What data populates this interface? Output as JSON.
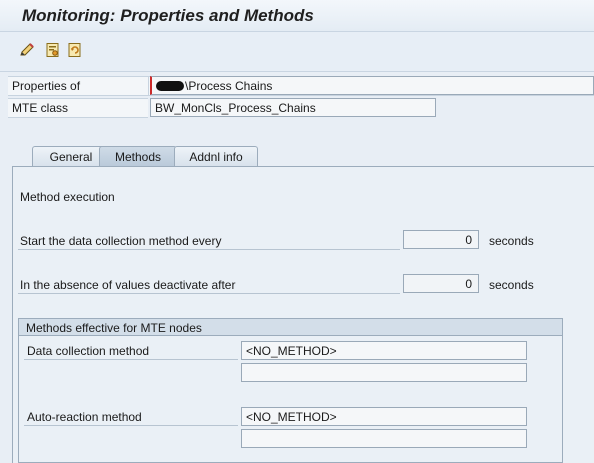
{
  "window": {
    "title": "Monitoring: Properties and Methods"
  },
  "toolbar": {
    "icons": [
      "change-pencil-icon",
      "details-icon",
      "refresh-icon"
    ]
  },
  "header": {
    "properties_label": "Properties of",
    "properties_value": "\\Process Chains",
    "mte_class_label": "MTE class",
    "mte_class_value": "BW_MonCls_Process_Chains"
  },
  "tabs": [
    {
      "label": "General",
      "active": false
    },
    {
      "label": "Methods",
      "active": true
    },
    {
      "label": "Addnl info",
      "active": false
    }
  ],
  "methods": {
    "section_title": "Method execution",
    "start_label": "Start the data collection method every",
    "start_value": "0",
    "start_unit": "seconds",
    "deactivate_label": "In the absence of values deactivate after",
    "deactivate_value": "0",
    "deactivate_unit": "seconds",
    "group": {
      "title": "Methods effective for MTE nodes",
      "data_collection_label": "Data collection method",
      "data_collection_value": "<NO_METHOD>",
      "data_collection_value2": "",
      "auto_reaction_label": "Auto-reaction method",
      "auto_reaction_value": "<NO_METHOD>",
      "auto_reaction_value2": ""
    }
  }
}
